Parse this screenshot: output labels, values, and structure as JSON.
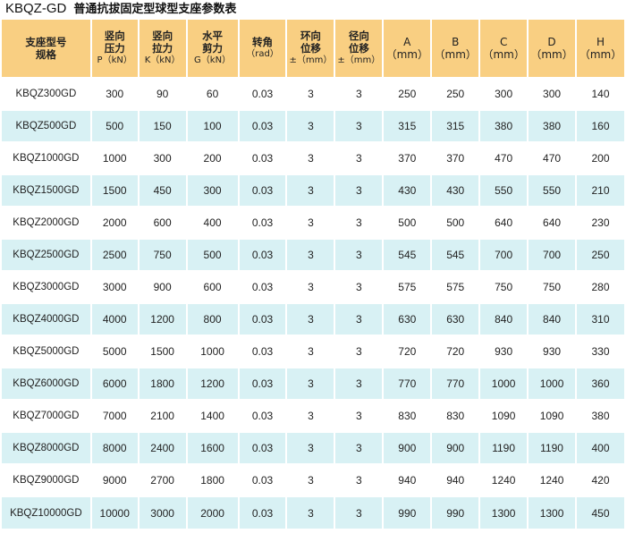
{
  "title": {
    "code": "KBQZ-GD",
    "desc": "普通抗拔固定型球型支座参数表"
  },
  "headers": [
    {
      "l1": "支座型号",
      "l2": "规格"
    },
    {
      "l1": "竖向",
      "l2": "压力",
      "l3": "P（kN）"
    },
    {
      "l1": "竖向",
      "l2": "拉力",
      "l3": "K（kN）"
    },
    {
      "l1": "水平",
      "l2": "剪力",
      "l3": "G（kN）"
    },
    {
      "l1": "转角",
      "l2": "（rad）"
    },
    {
      "l1": "环向",
      "l2": "位移",
      "l3": "±（mm）"
    },
    {
      "l1": "径向",
      "l2": "位移",
      "l3": "±（mm）"
    },
    {
      "l1": "A",
      "l2": "（mm）"
    },
    {
      "l1": "B",
      "l2": "（mm）"
    },
    {
      "l1": "C",
      "l2": "（mm）"
    },
    {
      "l1": "D",
      "l2": "（mm）"
    },
    {
      "l1": "H",
      "l2": "（mm）"
    }
  ],
  "rows": [
    [
      "KBQZ300GD",
      "300",
      "90",
      "60",
      "0.03",
      "3",
      "3",
      "250",
      "250",
      "300",
      "300",
      "140"
    ],
    [
      "KBQZ500GD",
      "500",
      "150",
      "100",
      "0.03",
      "3",
      "3",
      "315",
      "315",
      "380",
      "380",
      "160"
    ],
    [
      "KBQZ1000GD",
      "1000",
      "300",
      "200",
      "0.03",
      "3",
      "3",
      "370",
      "370",
      "470",
      "470",
      "200"
    ],
    [
      "KBQZ1500GD",
      "1500",
      "450",
      "300",
      "0.03",
      "3",
      "3",
      "430",
      "430",
      "550",
      "550",
      "210"
    ],
    [
      "KBQZ2000GD",
      "2000",
      "600",
      "400",
      "0.03",
      "3",
      "3",
      "500",
      "500",
      "640",
      "640",
      "230"
    ],
    [
      "KBQZ2500GD",
      "2500",
      "750",
      "500",
      "0.03",
      "3",
      "3",
      "545",
      "545",
      "700",
      "700",
      "250"
    ],
    [
      "KBQZ3000GD",
      "3000",
      "900",
      "600",
      "0.03",
      "3",
      "3",
      "575",
      "575",
      "750",
      "750",
      "280"
    ],
    [
      "KBQZ4000GD",
      "4000",
      "1200",
      "800",
      "0.03",
      "3",
      "3",
      "630",
      "630",
      "840",
      "840",
      "310"
    ],
    [
      "KBQZ5000GD",
      "5000",
      "1500",
      "1000",
      "0.03",
      "3",
      "3",
      "720",
      "720",
      "930",
      "930",
      "330"
    ],
    [
      "KBQZ6000GD",
      "6000",
      "1800",
      "1200",
      "0.03",
      "3",
      "3",
      "770",
      "770",
      "1000",
      "1000",
      "360"
    ],
    [
      "KBQZ7000GD",
      "7000",
      "2100",
      "1400",
      "0.03",
      "3",
      "3",
      "830",
      "830",
      "1090",
      "1090",
      "380"
    ],
    [
      "KBQZ8000GD",
      "8000",
      "2400",
      "1600",
      "0.03",
      "3",
      "3",
      "900",
      "900",
      "1190",
      "1190",
      "400"
    ],
    [
      "KBQZ9000GD",
      "9000",
      "2700",
      "1800",
      "0.03",
      "3",
      "3",
      "940",
      "940",
      "1240",
      "1240",
      "420"
    ],
    [
      "KBQZ10000GD",
      "10000",
      "3000",
      "2000",
      "0.03",
      "3",
      "3",
      "990",
      "990",
      "1300",
      "1300",
      "450"
    ]
  ],
  "colors": {
    "header_bg": "#f9cf82",
    "row_alt_bg": "#d8f1f4",
    "row_bg": "#ffffff"
  }
}
